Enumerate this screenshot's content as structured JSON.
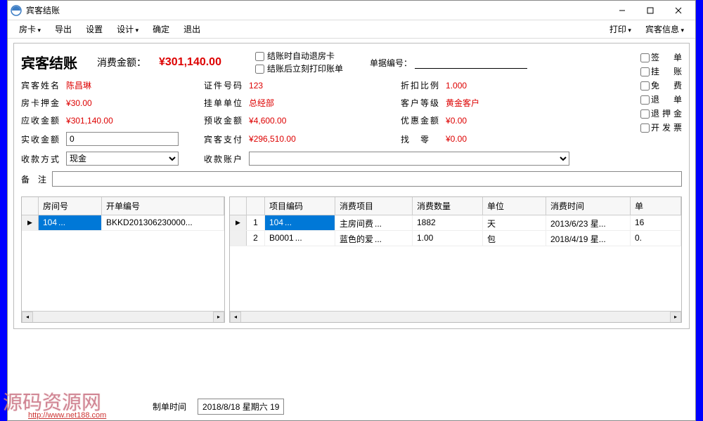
{
  "window": {
    "title": "宾客结账"
  },
  "menubar": {
    "left": [
      "房卡",
      "导出",
      "设置",
      "设计",
      "确定",
      "退出"
    ],
    "left_dropdown": [
      true,
      false,
      false,
      true,
      false,
      false
    ],
    "right": [
      "打印",
      "宾客信息"
    ],
    "right_dropdown": [
      true,
      true
    ]
  },
  "panel": {
    "title": "宾客结账",
    "amount_label": "消费金额：",
    "amount_value": "¥301,140.00",
    "check_auto_return": "结账时自动退房卡",
    "check_print_bill": "结账后立刻打印账单",
    "danhao_label": "单据编号：",
    "danhao_value": "",
    "side_checks": [
      "签　单",
      "挂　账",
      "免　费",
      "退　单",
      "退押金",
      "开发票"
    ]
  },
  "fields": {
    "guest_name_label": "宾客姓名",
    "guest_name": "陈昌琳",
    "id_no_label": "证件号码",
    "id_no": "123",
    "discount_label": "折扣比例",
    "discount": "1.000",
    "deposit_label": "房卡押金",
    "deposit": "¥30.00",
    "gua_unit_label": "挂单单位",
    "gua_unit": "总经部",
    "cust_level_label": "客户等级",
    "cust_level": "黄金客户",
    "receivable_label": "应收金额",
    "receivable": "¥301,140.00",
    "prepay_label": "预收金额",
    "prepay": "¥4,600.00",
    "discount_amt_label": "优惠金额",
    "discount_amt": "¥0.00",
    "actual_label": "实收金额",
    "actual": "0",
    "guest_pay_label": "宾客支付",
    "guest_pay": "¥296,510.00",
    "change_label": "找　零",
    "change": "¥0.00",
    "pay_method_label": "收款方式",
    "pay_method": "现金",
    "pay_account_label": "收款账户",
    "pay_account": "",
    "remark_label": "备　注",
    "remark": ""
  },
  "left_table": {
    "headers": [
      "房间号",
      "开单编号"
    ],
    "rows": [
      {
        "room": "104",
        "bill": "BKKD201306230000..."
      }
    ]
  },
  "right_table": {
    "headers": [
      "",
      "项目编码",
      "消费项目",
      "消费数量",
      "单位",
      "消费时间",
      "单"
    ],
    "rows": [
      {
        "idx": "1",
        "code": "104",
        "item": "主房间费",
        "qty": "1882",
        "unit": "天",
        "time": "2013/6/23 星...",
        "extra": "16"
      },
      {
        "idx": "2",
        "code": "B0001",
        "item": "蓝色的爱",
        "qty": "1.00",
        "unit": "包",
        "time": "2018/4/19 星...",
        "extra": "0."
      }
    ]
  },
  "footer": {
    "maker_label": "制单时间",
    "maker_time": "2018/8/18 星期六 19"
  },
  "watermark": {
    "text": "源码资源网",
    "url": "http://www.net188.com"
  }
}
